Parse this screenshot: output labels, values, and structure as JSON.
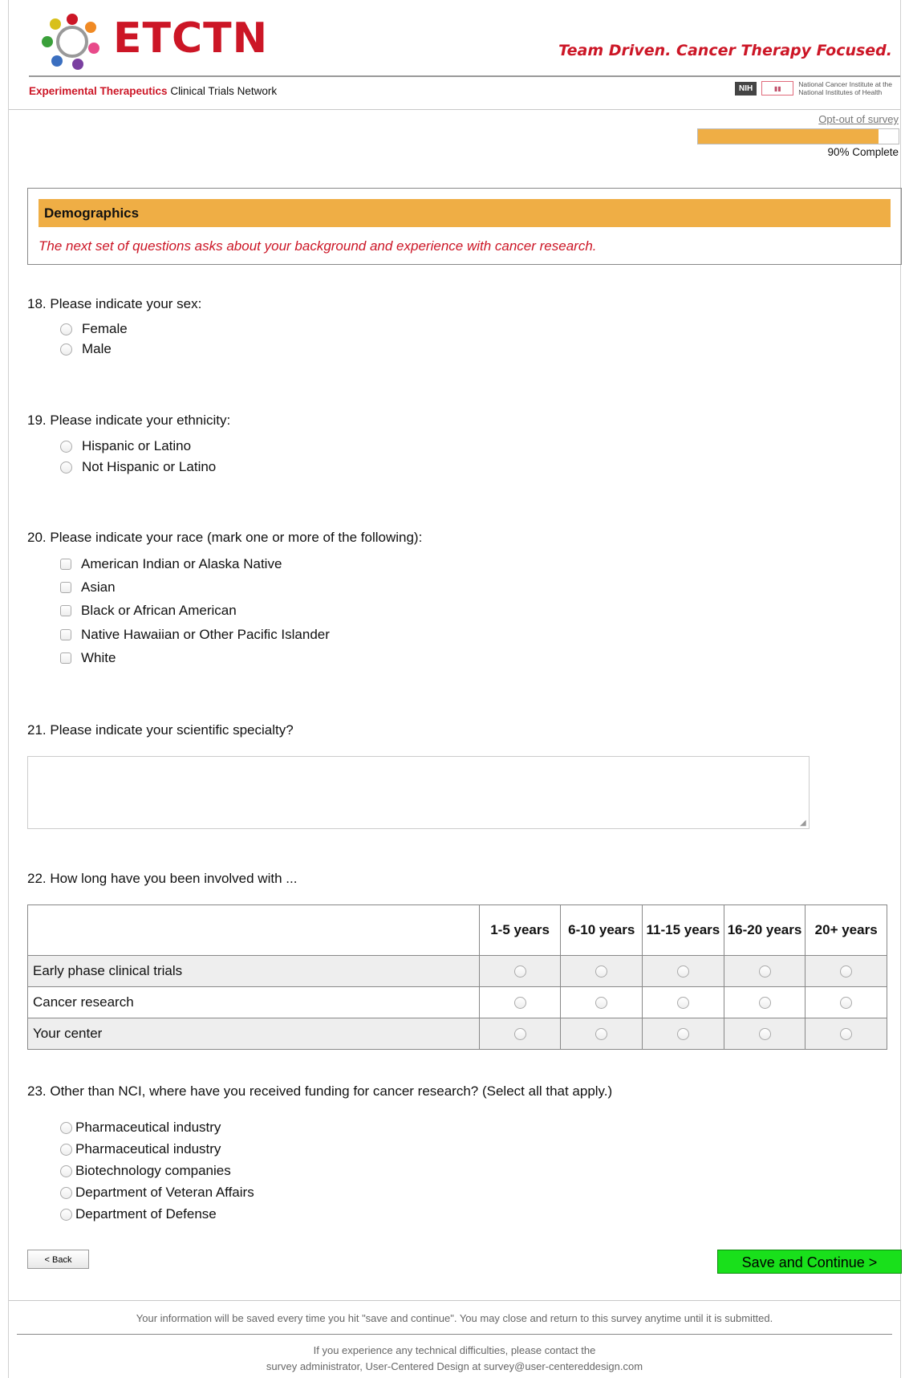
{
  "header": {
    "logo_text": "ETCTN",
    "tagline": "Team Driven. Cancer Therapy Focused.",
    "network_red": "Experimental Therapeutics",
    "network_rest": " Clinical Trials Network",
    "nih_badge": "NIH",
    "nci_line1": "National Cancer Institute at the",
    "nci_line2": "National Institutes of Health"
  },
  "progress": {
    "optout_label": "Opt-out of survey",
    "percent": 90,
    "percent_label": "90% Complete"
  },
  "section": {
    "title": "Demographics",
    "intro": "The next set of questions asks about your background and experience with cancer research."
  },
  "q18": {
    "label": "18. Please indicate your sex:",
    "options": [
      "Female",
      "Male"
    ]
  },
  "q19": {
    "label": "19. Please indicate your ethnicity:",
    "options": [
      "Hispanic or Latino",
      "Not Hispanic or Latino"
    ]
  },
  "q20": {
    "label": "20. Please indicate your race (mark one or more of the following):",
    "options": [
      "American Indian or Alaska Native",
      "Asian",
      "Black or African American",
      "Native Hawaiian or Other Pacific Islander",
      "White"
    ]
  },
  "q21": {
    "label": "21. Please indicate your scientific specialty?",
    "value": ""
  },
  "q22": {
    "label": "22. How long have you been involved with ...",
    "columns": [
      "1-5 years",
      "6-10 years",
      "11-15 years",
      "16-20 years",
      "20+ years"
    ],
    "rows": [
      "Early phase clinical trials",
      "Cancer research",
      "Your center"
    ]
  },
  "q23": {
    "label": "23. Other than NCI, where have you received funding for cancer research? (Select all that apply.)",
    "options": [
      "Pharmaceutical industry",
      "Pharmaceutical industry",
      "Biotechnology companies",
      "Department of Veteran Affairs",
      "Department of Defense"
    ]
  },
  "buttons": {
    "back": "< Back",
    "save": "Save and Continue >"
  },
  "footer": {
    "saved_note": "Your information will be saved every time you hit \"save and continue\". You may close and return to this survey anytime until it is submitted.",
    "contact_line1": "If you experience any technical difficulties, please contact the",
    "contact_line2": "survey administrator, User-Centered Design at ",
    "contact_email": "survey@user-centereddesign.com"
  },
  "colors": {
    "brand_red": "#cc1626",
    "accent_orange": "#efae45",
    "save_green": "#19e01b"
  }
}
